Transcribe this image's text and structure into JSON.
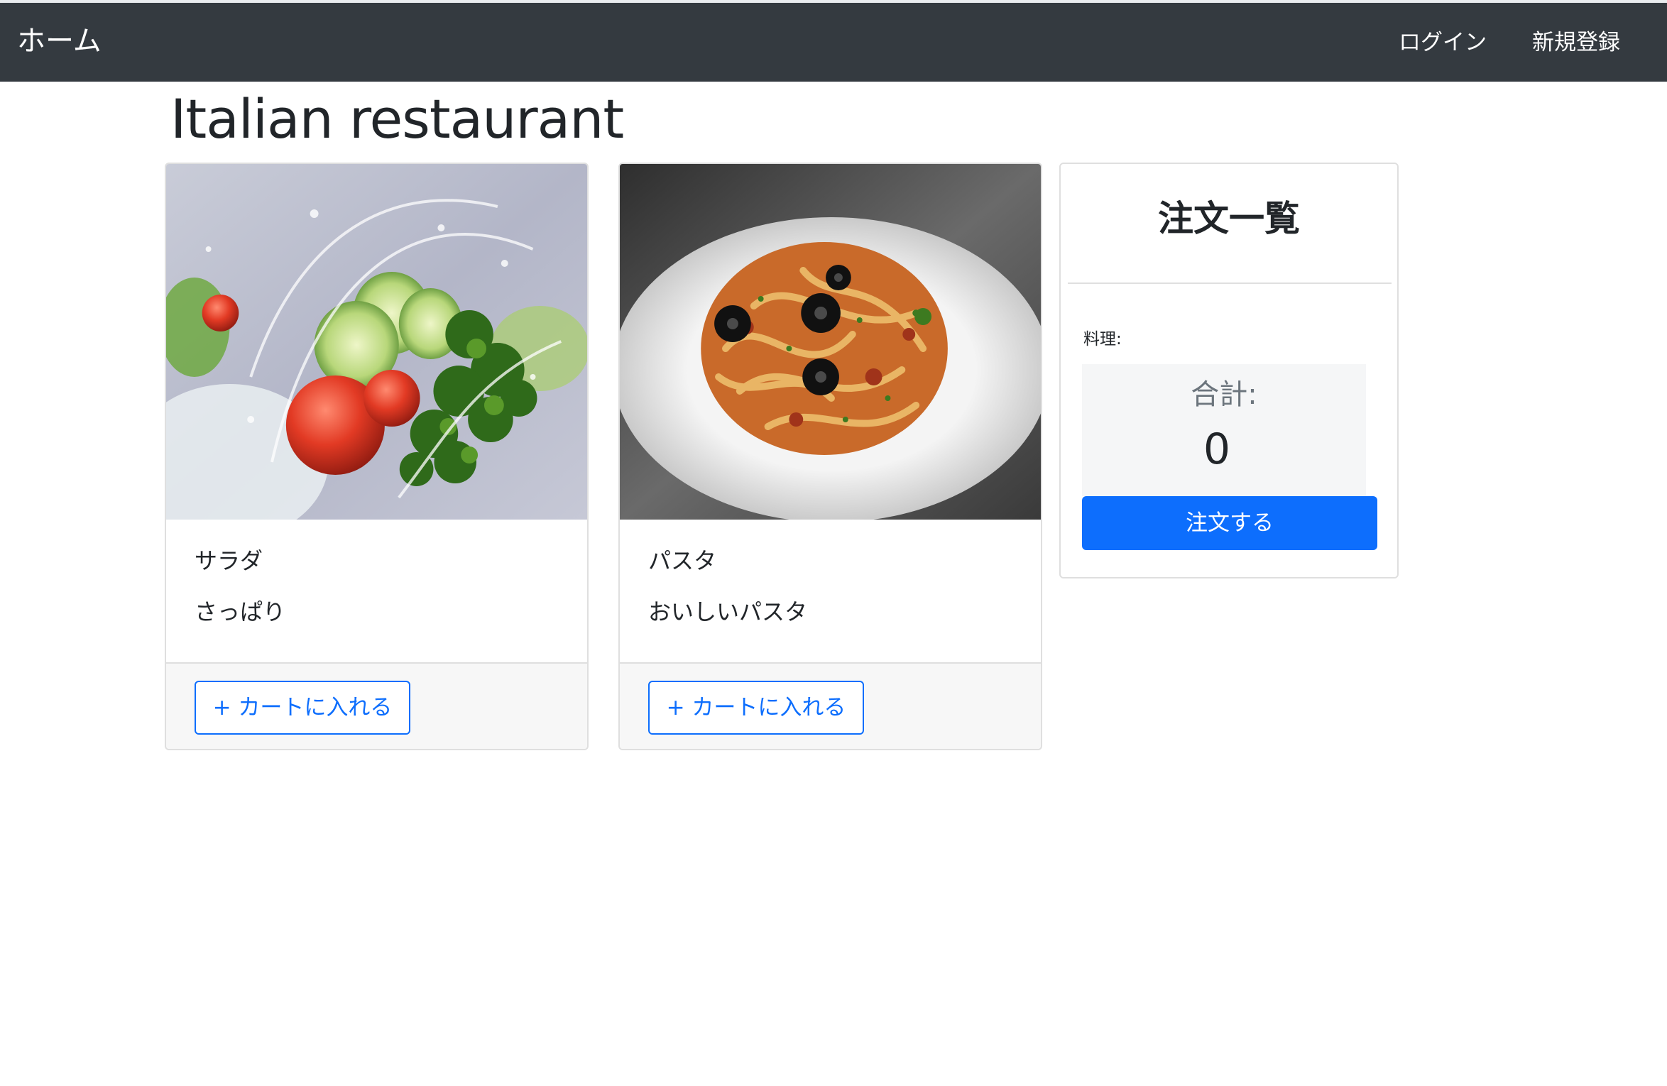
{
  "navbar": {
    "brand": "ホーム",
    "links": {
      "login": "ログイン",
      "register": "新規登録"
    }
  },
  "page": {
    "title": "Italian restaurant"
  },
  "menu_items": [
    {
      "name": "サラダ",
      "description": "さっぱり",
      "add_button": "+ カートに入れる",
      "image": "salad-photo"
    },
    {
      "name": "パスタ",
      "description": "おいしいパスタ",
      "add_button": "+ カートに入れる",
      "image": "pasta-photo"
    }
  ],
  "order": {
    "title": "注文一覧",
    "dish_label": "料理:",
    "total_label": "合計:",
    "total_value": "0",
    "submit_button": "注文する"
  },
  "colors": {
    "navbar": "#343a40",
    "primary": "#0d6efd",
    "card_border": "#dfdfdf",
    "card_footer": "#f7f7f7",
    "total_box": "#f5f6f7"
  }
}
